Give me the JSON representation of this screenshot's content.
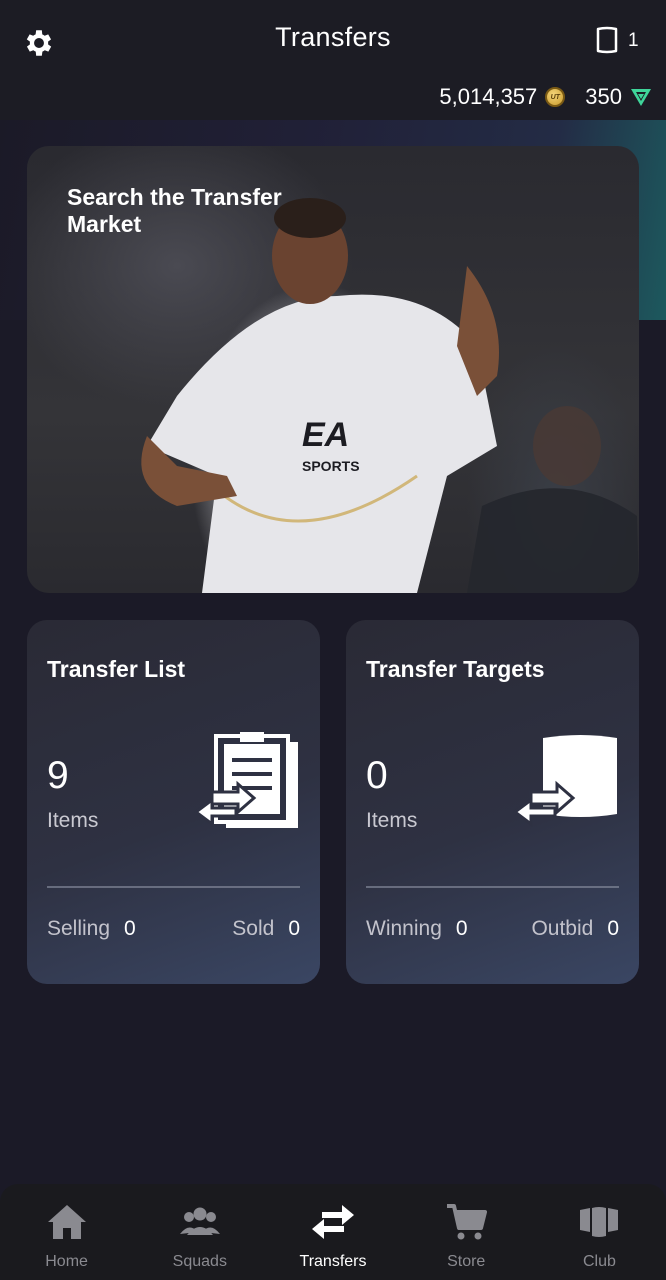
{
  "header": {
    "title": "Transfers",
    "squad_count": "1",
    "coins": "5,014,357",
    "coin_badge": "UT",
    "points": "350"
  },
  "hero": {
    "title": "Search the Transfer Market"
  },
  "cards": [
    {
      "title": "Transfer List",
      "count": "9",
      "unit": "Items",
      "stat_left_label": "Selling",
      "stat_left_value": "0",
      "stat_right_label": "Sold",
      "stat_right_value": "0"
    },
    {
      "title": "Transfer Targets",
      "count": "0",
      "unit": "Items",
      "stat_left_label": "Winning",
      "stat_left_value": "0",
      "stat_right_label": "Outbid",
      "stat_right_value": "0"
    }
  ],
  "nav": [
    {
      "label": "Home",
      "icon": "home-icon"
    },
    {
      "label": "Squads",
      "icon": "squads-icon"
    },
    {
      "label": "Transfers",
      "icon": "transfers-icon",
      "active": true
    },
    {
      "label": "Store",
      "icon": "store-icon"
    },
    {
      "label": "Club",
      "icon": "club-icon"
    }
  ],
  "colors": {
    "background": "#1b1a27",
    "card": "#2e3142",
    "accent_teal": "#1e8c8a",
    "coin_gold": "#e0b84a",
    "points_green": "#3fd59a"
  }
}
